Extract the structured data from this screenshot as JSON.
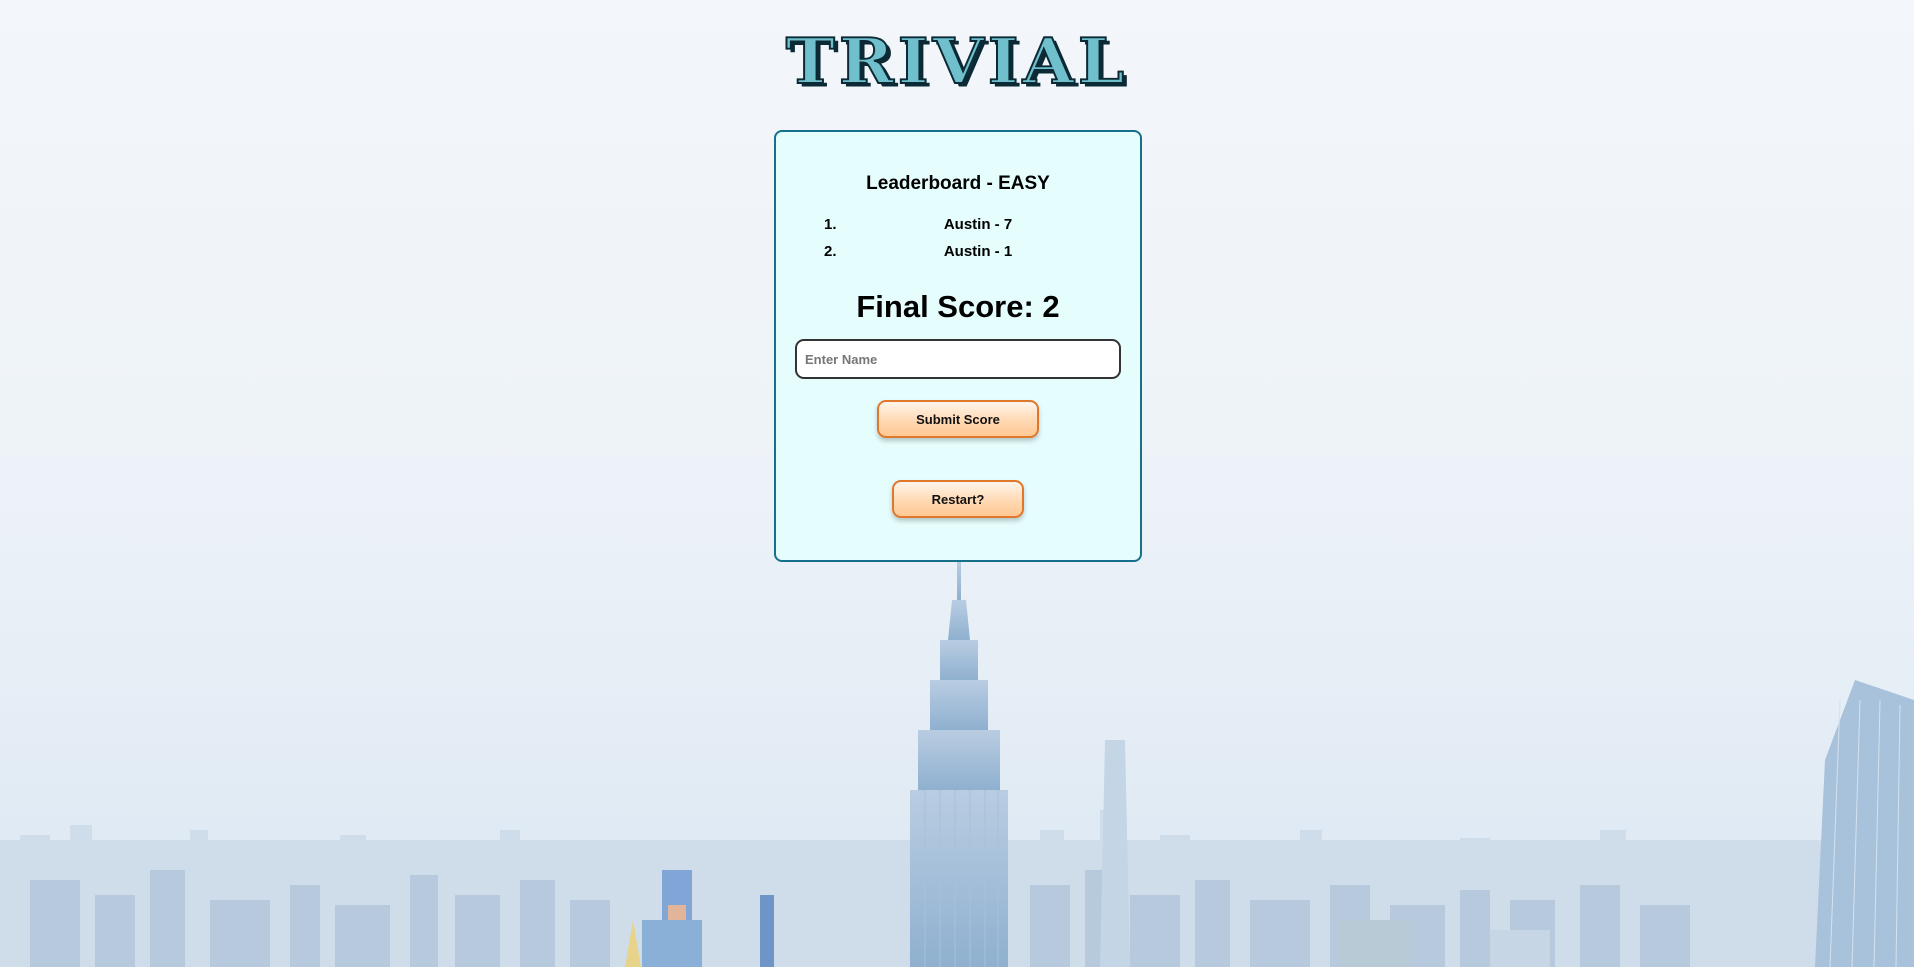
{
  "app": {
    "logo_text": "TRIVIAL"
  },
  "leaderboard": {
    "title": "Leaderboard - EASY",
    "entries": [
      {
        "rank": "1.",
        "text": "Austin - 7"
      },
      {
        "rank": "2.",
        "text": "Austin - 1"
      }
    ]
  },
  "score": {
    "final_label": "Final Score: 2"
  },
  "name_input": {
    "value": "",
    "placeholder": "Enter Name"
  },
  "buttons": {
    "submit_label": "Submit Score",
    "restart_label": "Restart?"
  },
  "colors": {
    "card_bg": "#e6fdfd",
    "card_border": "#16708a",
    "button_border": "#e0782c",
    "logo_fill": "#6fbfcc"
  }
}
